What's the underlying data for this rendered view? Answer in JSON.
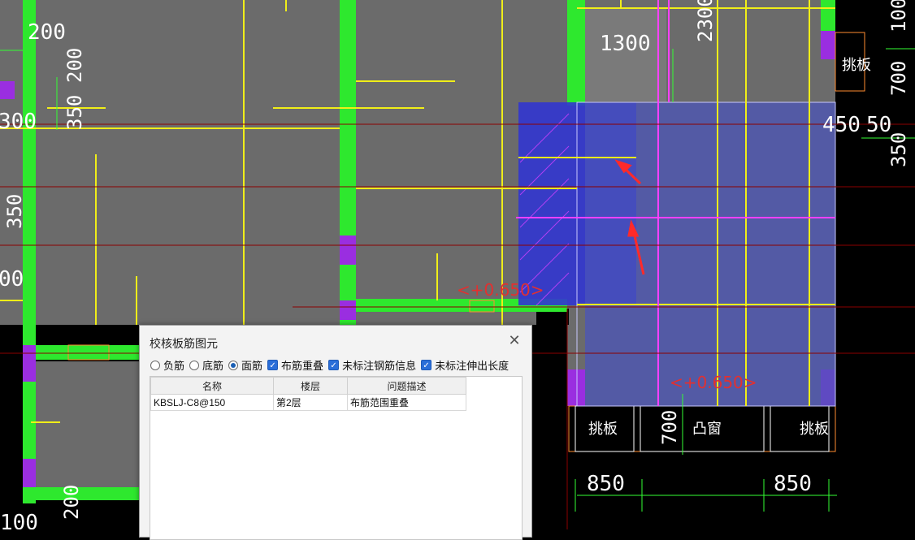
{
  "dialog": {
    "title": "校核板筋图元",
    "close_label": "✕",
    "radios": [
      {
        "label": "负筋",
        "selected": false
      },
      {
        "label": "底筋",
        "selected": false
      },
      {
        "label": "面筋",
        "selected": true
      }
    ],
    "checkboxes": [
      {
        "label": "布筋重叠",
        "checked": true
      },
      {
        "label": "未标注钢筋信息",
        "checked": true
      },
      {
        "label": "未标注伸出长度",
        "checked": true
      }
    ],
    "columns": [
      "名称",
      "楼层",
      "问题描述"
    ],
    "rows": [
      {
        "name": "KBSLJ-C8@150",
        "floor": "第2层",
        "issue": "布筋范围重叠"
      }
    ]
  },
  "drawing": {
    "colors": {
      "background": "#000000",
      "floor": "#6b6b6b",
      "wall": "#2ee82e",
      "rebar": "#f0ee18",
      "magenta": "#ff40ff",
      "blue": "#3a3fd8",
      "dim": "#33ff33",
      "red": "#ff2a2a",
      "axis": "#8b0000"
    },
    "dims": {
      "d200a": "200",
      "d200b": "200",
      "d350": "350",
      "d300": "300",
      "d350b": "350",
      "d00": "00",
      "d1300": "1300",
      "d2300": "2300",
      "d100": "100",
      "d700": "700",
      "d450": "450",
      "d50": "50",
      "d350c": "350",
      "d700b": "700",
      "d850a": "850",
      "d850b": "850",
      "d200c": "200",
      "d100b": "100"
    },
    "labels": {
      "elev1": "<+0.650>",
      "elev2": "<+0.650>",
      "tiao1": "挑板",
      "tiao2": "挑板",
      "tiao3": "挑板",
      "tuchuang": "凸窗"
    }
  }
}
